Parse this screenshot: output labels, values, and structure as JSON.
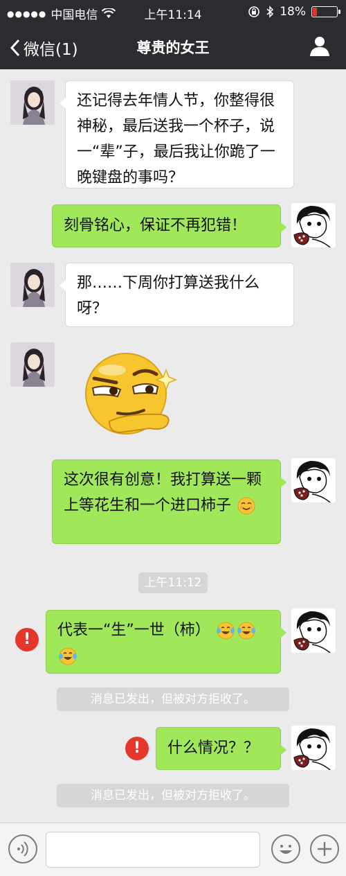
{
  "status_bar": {
    "signal_dots": "●●●●●",
    "carrier": "中国电信",
    "time": "上午11:14",
    "battery": "18%",
    "battery_level": 0.18,
    "battery_color": "#e0332b"
  },
  "nav": {
    "back_label": "微信(1)",
    "title": "尊贵的女王",
    "user_icon": "person-icon"
  },
  "messages": [
    {
      "side": "left",
      "type": "text",
      "text": "还记得去年情人节，你整得很神秘，最后送我一个杯子，说一“辈”子，最后我让你跪了一晚键盘的事吗？"
    },
    {
      "side": "right",
      "type": "text",
      "text": "刻骨铭心，保证不再犯错！"
    },
    {
      "side": "left",
      "type": "text",
      "text": "那……下周你打算送我什么呀？"
    },
    {
      "side": "left",
      "type": "sticker",
      "sticker": "smirk-emoji"
    },
    {
      "side": "right",
      "type": "text",
      "text": "这次很有创意！我打算送一颗上等花生和一个进口柿子",
      "trailing_emoji": "smile-emoji"
    },
    {
      "side": "right",
      "type": "text",
      "text": "代表一“生”一世（柿）",
      "trailing_emojis": [
        "laugh-cry-emoji",
        "laugh-cry-emoji",
        "laugh-cry-emoji"
      ],
      "status": "failed"
    },
    {
      "side": "right",
      "type": "text",
      "text": "什么情况？？",
      "status": "failed"
    }
  ],
  "timestamp": "上午11:12",
  "system_notices": [
    "消息已发出，但被对方拒收了。",
    "消息已发出，但被对方拒收了。"
  ],
  "error_mark": "!",
  "colors": {
    "header_bg": "#2c2c30",
    "chat_bg": "#ebebeb",
    "bubble_green": "#a0e75a",
    "error_red": "#e6352b"
  }
}
